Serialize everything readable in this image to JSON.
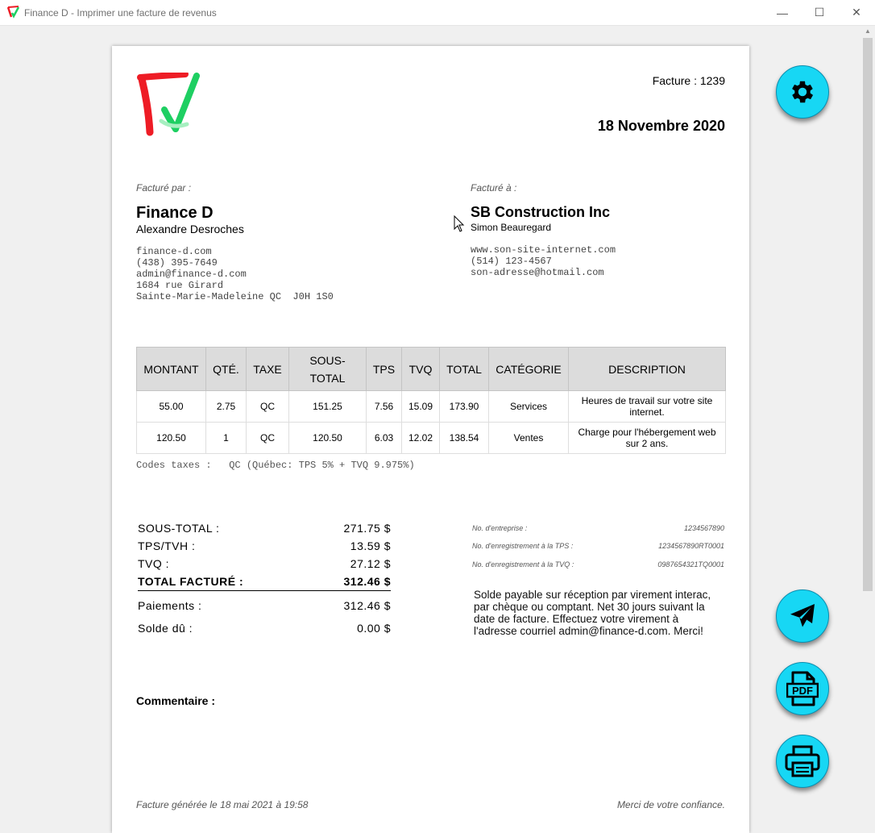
{
  "window": {
    "title": "Finance D - Imprimer une facture de revenus",
    "minimize_glyph": "—",
    "maximize_glyph": "☐",
    "close_glyph": "✕"
  },
  "invoice": {
    "number_label": "Facture : 1239",
    "date": "18 Novembre 2020"
  },
  "billed_by": {
    "label": "Facturé par :",
    "company": "Finance D",
    "person": "Alexandre Desroches",
    "lines": [
      "finance-d.com",
      "(438) 395-7649",
      "admin@finance-d.com",
      "1684 rue Girard",
      "Sainte-Marie-Madeleine QC  J0H 1S0"
    ]
  },
  "billed_to": {
    "label": "Facturé à :",
    "company": "SB Construction Inc",
    "person": "Simon Beauregard",
    "lines": [
      "www.son-site-internet.com",
      "(514) 123-4567",
      "son-adresse@hotmail.com"
    ]
  },
  "table": {
    "headers": [
      "MONTANT",
      "QTÉ.",
      "TAXE",
      "SOUS-TOTAL",
      "TPS",
      "TVQ",
      "TOTAL",
      "CATÉGORIE",
      "DESCRIPTION"
    ],
    "rows": [
      [
        "55.00",
        "2.75",
        "QC",
        "151.25",
        "7.56",
        "15.09",
        "173.90",
        "Services",
        "Heures de travail sur votre site internet."
      ],
      [
        "120.50",
        "1",
        "QC",
        "120.50",
        "6.03",
        "12.02",
        "138.54",
        "Ventes",
        "Charge pour l'hébergement web sur 2 ans."
      ]
    ]
  },
  "tax_codes": "Codes taxes :   QC (Québec: TPS 5% + TVQ 9.975%)",
  "totals": {
    "subtotal_label": "SOUS-TOTAL :",
    "subtotal": "271.75 $",
    "tps_label": "TPS/TVH :",
    "tps": "13.59 $",
    "tvq_label": "TVQ :",
    "tvq": "27.12 $",
    "total_label": "TOTAL FACTURÉ :",
    "total": "312.46 $",
    "payments_label": "Paiements :",
    "payments": "312.46 $",
    "due_label": "Solde dû :",
    "due": "0.00 $"
  },
  "registration": {
    "enterprise_label": "No. d'entreprise :",
    "enterprise": "1234567890",
    "tps_label": "No. d'enregistrement à la TPS :",
    "tps": "1234567890RT0001",
    "tvq_label": "No. d'enregistrement à la TVQ :",
    "tvq": "0987654321TQ0001"
  },
  "terms": "Solde payable sur réception par virement interac, par chèque ou comptant. Net 30 jours suivant la date de facture.  Effectuez votre virement à l'adresse courriel admin@finance-d.com. Merci!",
  "comment_label": "Commentaire :",
  "footer": {
    "generated": "Facture générée le 18 mai 2021 à 19:58",
    "thanks": "Merci de votre confiance."
  },
  "actions": {
    "settings_icon": "gear-icon",
    "send_icon": "paper-plane-icon",
    "pdf_icon": "pdf-file-icon",
    "pdf_text": "PDF",
    "print_icon": "printer-icon"
  },
  "colors": {
    "fab": "#17d7f4",
    "logo_red": "#ee1c25",
    "logo_green": "#1ecf62",
    "header_bg": "#dcdcdc"
  }
}
